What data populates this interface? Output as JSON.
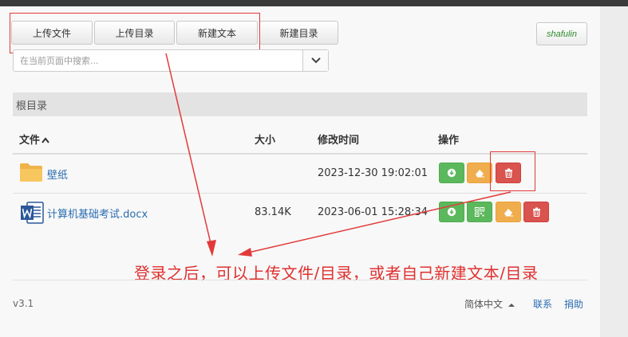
{
  "toolbar": {
    "upload_file": "上传文件",
    "upload_dir": "上传目录",
    "new_text": "新建文本",
    "new_dir": "新建目录"
  },
  "user": "shafulin",
  "search": {
    "placeholder": "在当前页面中搜索..."
  },
  "breadcrumb": "根目录",
  "table": {
    "headers": {
      "file": "文件",
      "size": "大小",
      "modified": "修改时间",
      "actions": "操作"
    },
    "rows": [
      {
        "name": "壁纸",
        "size": "",
        "modified": "2023-12-30 19:02:01",
        "type": "folder"
      },
      {
        "name": "计算机基础考试.docx",
        "size": "83.14K",
        "modified": "2023-06-01 15:28:34",
        "type": "word"
      }
    ]
  },
  "annotation": "登录之后，可以上传文件/目录，或者自己新建文本/目录",
  "footer": {
    "version": "v3.1",
    "language": "简体中文",
    "contact": "联系",
    "donate": "捐助"
  },
  "colors": {
    "annotation_red": "#e03030",
    "link_blue": "#2a6cb0",
    "success_green": "#5cb85c",
    "warning_orange": "#f0ad4e",
    "danger_red": "#d9534f"
  }
}
